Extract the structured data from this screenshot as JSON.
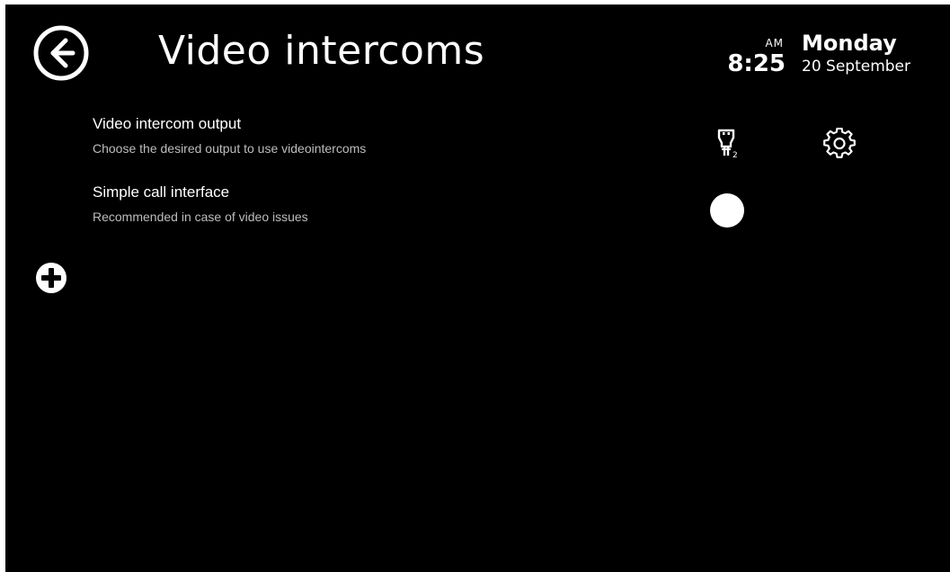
{
  "header": {
    "title": "Video intercoms",
    "back_icon": "arrow-left-circle-icon"
  },
  "clock": {
    "ampm": "AM",
    "time": "8:25",
    "day": "Monday",
    "date": "20 September"
  },
  "settings": [
    {
      "title": "Video intercom output",
      "description": "Choose the desired output to use videointercoms",
      "icons": [
        "hdmi-output-2-icon",
        "gear-icon"
      ]
    },
    {
      "title": "Simple call interface",
      "description": "Recommended in case of video issues",
      "toggle_state": "off"
    }
  ],
  "add_icon": "plus-circle-icon",
  "colors": {
    "background": "#000000",
    "text": "#ffffff",
    "secondary_text": "#bdbdbd"
  }
}
